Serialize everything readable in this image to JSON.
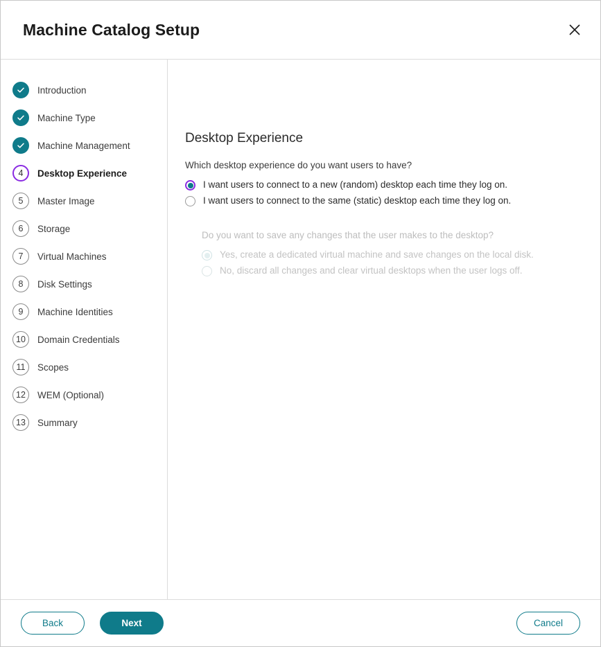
{
  "colors": {
    "teal": "#0f7b8a",
    "purple": "#8a2be2",
    "border": "#dcdcdc",
    "disabled_text": "#bdbdbd"
  },
  "header": {
    "title": "Machine Catalog Setup",
    "close_icon": "close-icon"
  },
  "sidebar": {
    "steps": [
      {
        "number": "1",
        "label": "Introduction",
        "state": "done"
      },
      {
        "number": "2",
        "label": "Machine Type",
        "state": "done"
      },
      {
        "number": "3",
        "label": "Machine Management",
        "state": "done"
      },
      {
        "number": "4",
        "label": "Desktop Experience",
        "state": "current"
      },
      {
        "number": "5",
        "label": "Master Image",
        "state": "pending"
      },
      {
        "number": "6",
        "label": "Storage",
        "state": "pending"
      },
      {
        "number": "7",
        "label": "Virtual Machines",
        "state": "pending"
      },
      {
        "number": "8",
        "label": "Disk Settings",
        "state": "pending"
      },
      {
        "number": "9",
        "label": "Machine Identities",
        "state": "pending"
      },
      {
        "number": "10",
        "label": "Domain Credentials",
        "state": "pending"
      },
      {
        "number": "11",
        "label": "Scopes",
        "state": "pending"
      },
      {
        "number": "12",
        "label": "WEM (Optional)",
        "state": "pending"
      },
      {
        "number": "13",
        "label": "Summary",
        "state": "pending"
      }
    ]
  },
  "main": {
    "page_title": "Desktop Experience",
    "question_primary": "Which desktop experience do you want users to have?",
    "options_primary": [
      {
        "label": "I want users to connect to a new (random) desktop each time they log on.",
        "checked": true,
        "disabled": false
      },
      {
        "label": "I want users to connect to the same (static) desktop each time they log on.",
        "checked": false,
        "disabled": false
      }
    ],
    "question_secondary": "Do you want to save any changes that the user makes to the desktop?",
    "options_secondary": [
      {
        "label": "Yes, create a dedicated virtual machine and save changes on the local disk.",
        "checked": true,
        "disabled": true
      },
      {
        "label": "No, discard all changes and clear virtual desktops when the user logs off.",
        "checked": false,
        "disabled": true
      }
    ]
  },
  "footer": {
    "back_label": "Back",
    "next_label": "Next",
    "cancel_label": "Cancel"
  }
}
